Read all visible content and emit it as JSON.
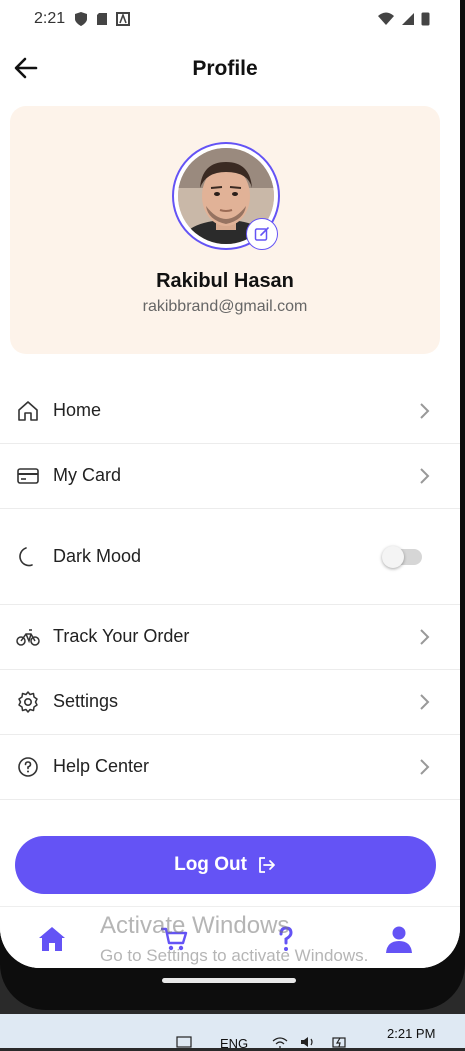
{
  "status_bar": {
    "time": "2:21"
  },
  "header": {
    "title": "Profile"
  },
  "profile": {
    "name": "Rakibul Hasan",
    "email": "rakibbrand@gmail.com"
  },
  "menu": [
    {
      "label": "Home",
      "icon": "home-icon",
      "trailing": "chevron"
    },
    {
      "label": "My Card",
      "icon": "card-icon",
      "trailing": "chevron"
    },
    {
      "label": "Dark Mood",
      "icon": "moon-icon",
      "trailing": "toggle",
      "toggle_on": false
    },
    {
      "label": "Track Your Order",
      "icon": "bicycle-icon",
      "trailing": "chevron"
    },
    {
      "label": "Settings",
      "icon": "gear-icon",
      "trailing": "chevron"
    },
    {
      "label": "Help Center",
      "icon": "help-icon",
      "trailing": "chevron"
    }
  ],
  "logout": {
    "label": "Log Out"
  },
  "bottom_nav": [
    {
      "icon": "home-icon",
      "active": true
    },
    {
      "icon": "cart-icon",
      "active": false
    },
    {
      "icon": "question-icon",
      "active": false
    },
    {
      "icon": "user-icon",
      "active": true
    }
  ],
  "watermark": {
    "line1": "Activate Windows",
    "line2": "Go to Settings to activate Windows."
  },
  "taskbar": {
    "language": "ENG",
    "time": "2:21 PM"
  },
  "colors": {
    "accent": "#6453f5",
    "card_bg": "#fdf3ea"
  }
}
